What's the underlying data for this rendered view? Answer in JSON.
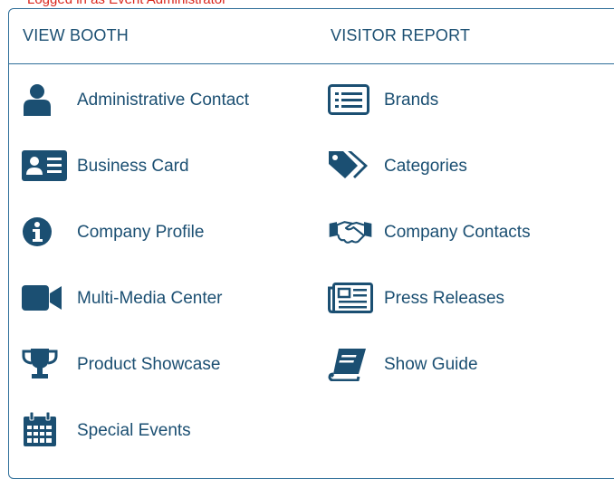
{
  "top_note": "Logged in as Event Administrator",
  "colors": {
    "accent": "#1b4f72",
    "border": "#2e6e99",
    "alert": "#d9261c"
  },
  "left_column": {
    "title": "VIEW BOOTH",
    "items": [
      {
        "label": "Administrative Contact",
        "icon": "user-icon"
      },
      {
        "label": "Business Card",
        "icon": "id-card-icon"
      },
      {
        "label": "Company Profile",
        "icon": "info-icon"
      },
      {
        "label": "Multi-Media Center",
        "icon": "video-camera-icon"
      },
      {
        "label": "Product Showcase",
        "icon": "trophy-icon"
      },
      {
        "label": "Special Events",
        "icon": "calendar-icon"
      }
    ]
  },
  "right_column": {
    "title": "VISITOR REPORT",
    "items": [
      {
        "label": "Brands",
        "icon": "list-alt-icon"
      },
      {
        "label": "Categories",
        "icon": "tags-icon"
      },
      {
        "label": "Company Contacts",
        "icon": "handshake-icon"
      },
      {
        "label": "Press Releases",
        "icon": "newspaper-icon"
      },
      {
        "label": "Show Guide",
        "icon": "book-icon"
      }
    ]
  }
}
